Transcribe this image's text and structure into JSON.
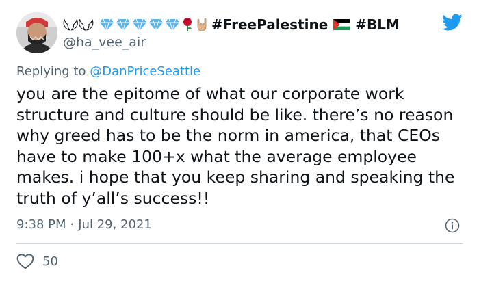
{
  "user": {
    "display_name": "𓆩𓆪𓆩𓆪",
    "hashtag_1": "#FreePalestine",
    "hashtag_2": "#BLM",
    "handle": "@ha_vee_air",
    "emojis": [
      "diamond-icon",
      "diamond-icon",
      "diamond-icon",
      "diamond-icon",
      "diamond-icon",
      "rose-icon",
      "rock-hand-icon",
      "palestine-flag-icon"
    ]
  },
  "tweet": {
    "reply_prefix": "Replying to ",
    "reply_to": "@DanPriceSeattle",
    "text": "you are the epitome of what our corporate work structure and culture should be like. there’s no reason why greed has to be the norm in america, that CEOs have to make 100+x what the average employee makes. i hope that you keep sharing and speaking the truth of y’all’s success!!",
    "time": "9:38 PM",
    "separator": "·",
    "date": "Jul 29, 2021",
    "likes": "50"
  },
  "colors": {
    "brand_blue": "#1d9bf0",
    "text_primary": "#0f1419",
    "text_secondary": "#536471",
    "diamond": "#57b4f0",
    "rose": "#c8102e"
  }
}
